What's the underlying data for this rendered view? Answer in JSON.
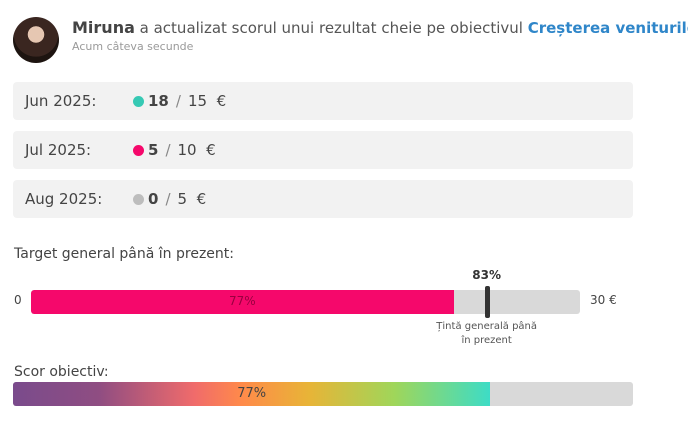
{
  "activity": {
    "user_name": "Miruna",
    "action_text": "a actualizat scorul unui rezultat cheie pe obiectivul",
    "objective_link": "Creșterea veniturilor",
    "trailing": ".",
    "time_ago": "Acum câteva secunde"
  },
  "months": [
    {
      "label": "Jun 2025:",
      "current": "18",
      "target": "15",
      "currency": "€",
      "status_color": "#36c9b4"
    },
    {
      "label": "Jul 2025:",
      "current": "5",
      "target": "10",
      "currency": "€",
      "status_color": "#f5086b"
    },
    {
      "label": "Aug 2025:",
      "current": "0",
      "target": "5",
      "currency": "€",
      "status_color": "#bdbdbd"
    }
  ],
  "separator": "/",
  "overall_target": {
    "title": "Target general până în prezent:",
    "min_label": "0",
    "max_label": "30 €",
    "progress_fraction": 0.77,
    "progress_label": "77%",
    "target_fraction": 0.83,
    "target_label": "83%",
    "target_caption": "Țintă generală până în prezent",
    "fill_color": "#f5086b"
  },
  "score": {
    "title": "Scor obiectiv:",
    "fraction": 0.77,
    "label": "77%"
  }
}
